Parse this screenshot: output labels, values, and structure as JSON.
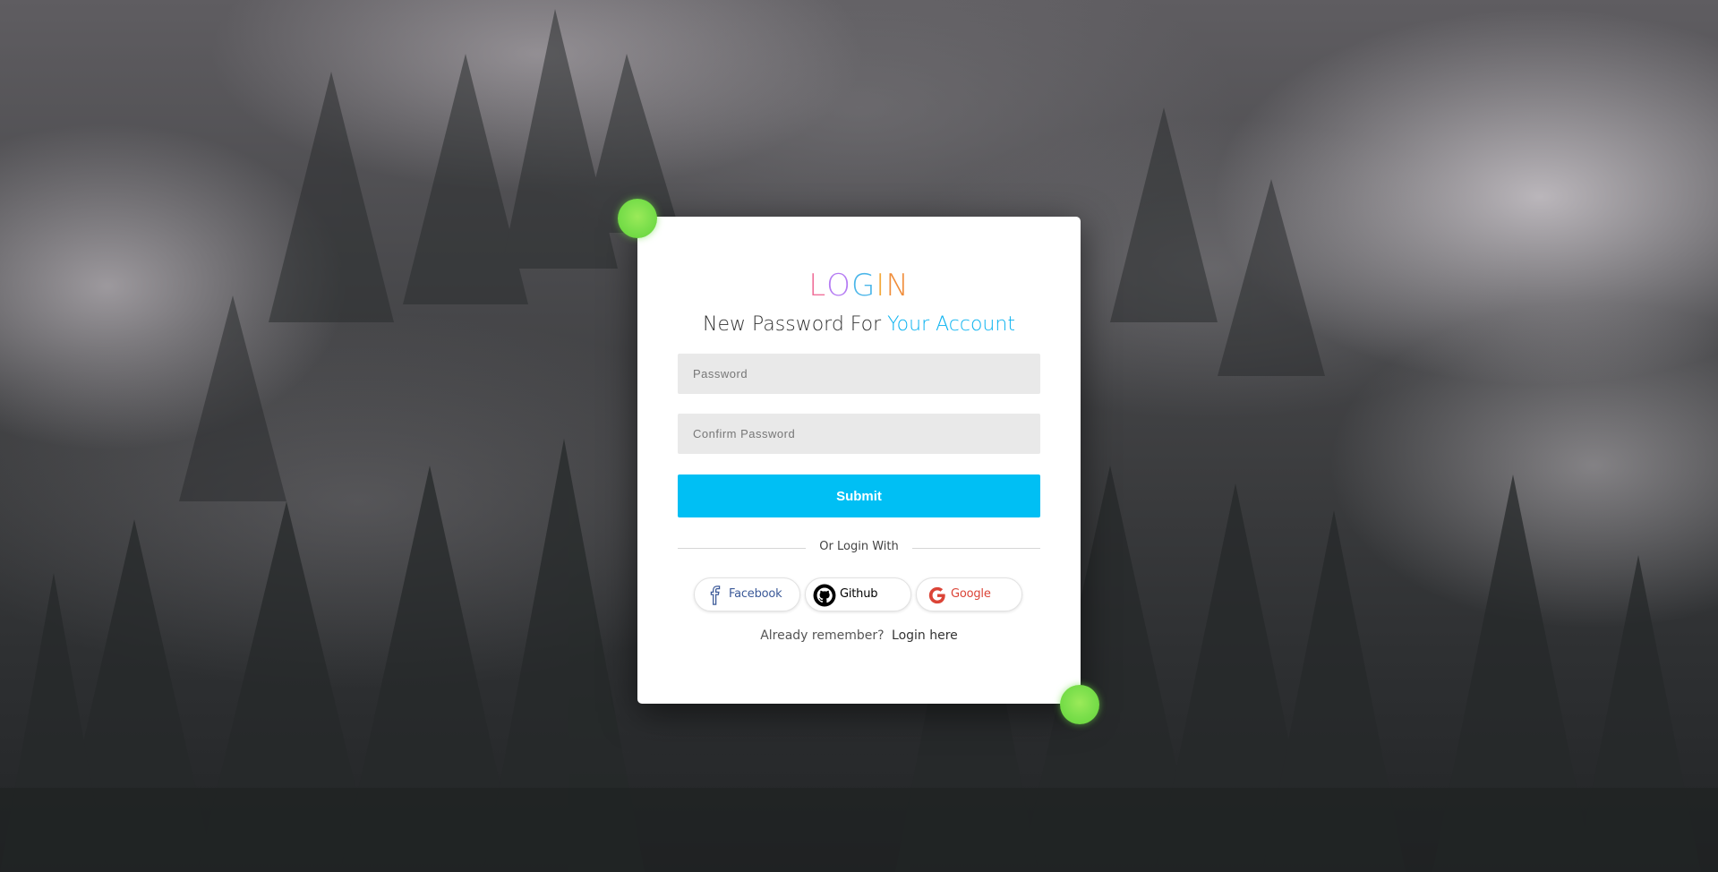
{
  "logo": {
    "letters": [
      "L",
      "O",
      "G",
      "I",
      "N"
    ],
    "colors": [
      "#f0719a",
      "#b57cf3",
      "#4bb6e9",
      "#f3a93b",
      "#f08d3a"
    ]
  },
  "heading": {
    "prefix": "New Password For",
    "accent": "Your Account"
  },
  "form": {
    "password_placeholder": "Password",
    "password_value": "",
    "confirm_placeholder": "Confirm Password",
    "confirm_value": "",
    "submit_label": "Submit"
  },
  "divider": {
    "label": "Or Login With"
  },
  "social": {
    "facebook": {
      "label": "Facebook",
      "icon": "facebook-icon",
      "color": "#3b5998"
    },
    "github": {
      "label": "Github",
      "icon": "github-icon",
      "color": "#000000"
    },
    "google": {
      "label": "Google",
      "icon": "google-icon",
      "color": "#db4437"
    }
  },
  "footer": {
    "prompt": "Already remember?",
    "link": "Login here"
  },
  "colors": {
    "accent": "#00bff4",
    "glow_dot": "#7ee04d"
  }
}
